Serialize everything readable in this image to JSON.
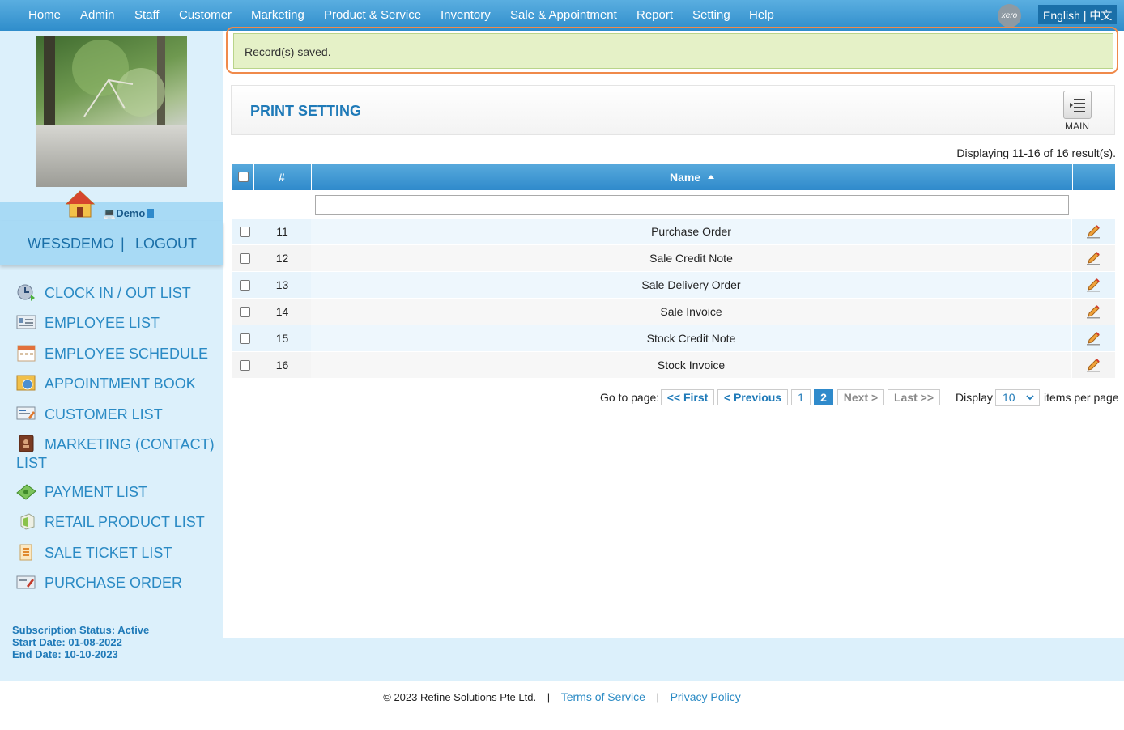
{
  "nav": {
    "items": [
      "Home",
      "Admin",
      "Staff",
      "Customer",
      "Marketing",
      "Product & Service",
      "Inventory",
      "Sale & Appointment",
      "Report",
      "Setting",
      "Help"
    ],
    "xero": "xero",
    "lang_en": "English",
    "lang_sep": "|",
    "lang_zh": "中文"
  },
  "sidebar": {
    "demo": "Demo",
    "user": "WESSDEMO",
    "sep": "|",
    "logout": "LOGOUT",
    "menu": [
      {
        "label": "CLOCK IN / OUT LIST",
        "icon": "clock-icon"
      },
      {
        "label": "EMPLOYEE LIST",
        "icon": "employee-icon"
      },
      {
        "label": "EMPLOYEE SCHEDULE",
        "icon": "calendar-icon"
      },
      {
        "label": "APPOINTMENT BOOK",
        "icon": "book-icon"
      },
      {
        "label": "CUSTOMER LIST",
        "icon": "customer-icon"
      },
      {
        "label": "MARKETING (CONTACT) LIST",
        "icon": "contact-book-icon"
      },
      {
        "label": "PAYMENT LIST",
        "icon": "money-icon"
      },
      {
        "label": "RETAIL PRODUCT LIST",
        "icon": "box-icon"
      },
      {
        "label": "SALE TICKET LIST",
        "icon": "ticket-icon"
      },
      {
        "label": "PURCHASE ORDER",
        "icon": "purchase-icon"
      }
    ],
    "subscription_status": "Subscription Status: Active",
    "start_date": "Start Date: 01-08-2022",
    "end_date": "End Date: 10-10-2023"
  },
  "alert": {
    "message": "Record(s) saved."
  },
  "panel": {
    "title": "PRINT SETTING",
    "main_label": "MAIN"
  },
  "table": {
    "displaying": "Displaying 11-16 of 16 result(s).",
    "col_num": "#",
    "col_name": "Name",
    "rows": [
      {
        "num": "11",
        "name": "Purchase Order"
      },
      {
        "num": "12",
        "name": "Sale Credit Note"
      },
      {
        "num": "13",
        "name": "Sale Delivery Order"
      },
      {
        "num": "14",
        "name": "Sale Invoice"
      },
      {
        "num": "15",
        "name": "Stock Credit Note"
      },
      {
        "num": "16",
        "name": "Stock Invoice"
      }
    ]
  },
  "pager": {
    "goto": "Go to page:",
    "first": "<< First",
    "previous": "< Previous",
    "page1": "1",
    "page2": "2",
    "next": "Next >",
    "last": "Last >>",
    "display": "Display",
    "per_page_value": "10",
    "items_per_page": "items per page"
  },
  "footer": {
    "copyright": "© 2023 Refine Solutions Pte Ltd.",
    "sep": "|",
    "terms": "Terms of Service",
    "privacy": "Privacy Policy"
  },
  "colors": {
    "nav_blue": "#2f8dcb",
    "link_blue": "#2a8ac4",
    "alert_border": "#f08a4b",
    "alert_bg": "#e5f1c7"
  }
}
